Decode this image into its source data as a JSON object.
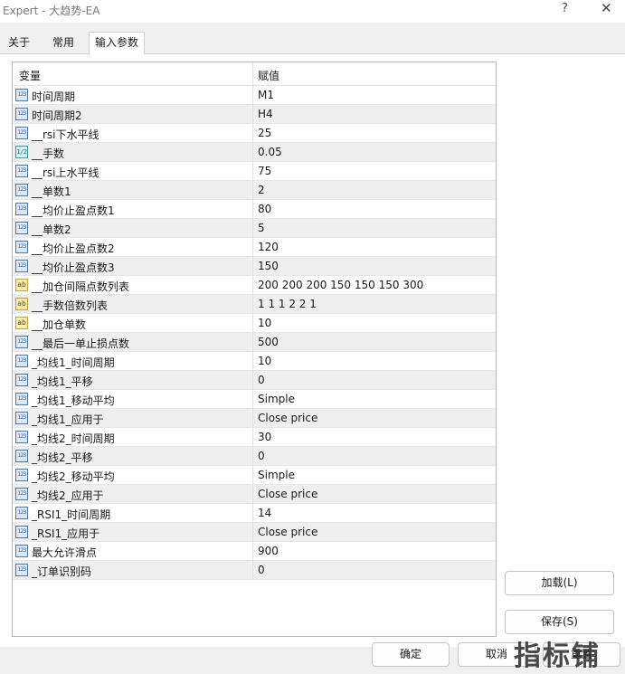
{
  "window": {
    "title": "Expert - 大趋势-EA",
    "help_label": "?",
    "close_label": "✕"
  },
  "tabs": [
    {
      "label": "关于"
    },
    {
      "label": "常用"
    },
    {
      "label": "输入参数"
    }
  ],
  "table": {
    "headers": {
      "name": "变量",
      "value": "赋值"
    },
    "rows": [
      {
        "icon": "123",
        "name": "时间周期",
        "value": "M1"
      },
      {
        "icon": "123",
        "name": "时间周期2",
        "value": "H4"
      },
      {
        "icon": "123",
        "name": "__rsi下水平线",
        "value": "25"
      },
      {
        "icon": "1/2",
        "name": "__手数",
        "value": "0.05"
      },
      {
        "icon": "123",
        "name": "__rsi上水平线",
        "value": "75"
      },
      {
        "icon": "123",
        "name": "__单数1",
        "value": "2"
      },
      {
        "icon": "123",
        "name": "__均价止盈点数1",
        "value": "80"
      },
      {
        "icon": "123",
        "name": "__单数2",
        "value": "5"
      },
      {
        "icon": "123",
        "name": "__均价止盈点数2",
        "value": "120"
      },
      {
        "icon": "123",
        "name": "__均价止盈点数3",
        "value": "150"
      },
      {
        "icon": "ab",
        "name": "__加仓间隔点数列表",
        "value": "200 200 200 150 150 150 300"
      },
      {
        "icon": "ab",
        "name": "__手数倍数列表",
        "value": "1 1 1 2 2 1"
      },
      {
        "icon": "ab",
        "name": "__加仓单数",
        "value": "10"
      },
      {
        "icon": "123",
        "name": "__最后一单止损点数",
        "value": "500"
      },
      {
        "icon": "123",
        "name": "_均线1_时间周期",
        "value": "10"
      },
      {
        "icon": "123",
        "name": "_均线1_平移",
        "value": "0"
      },
      {
        "icon": "123",
        "name": "_均线1_移动平均",
        "value": "Simple"
      },
      {
        "icon": "123",
        "name": "_均线1_应用于",
        "value": "Close price"
      },
      {
        "icon": "123",
        "name": "_均线2_时间周期",
        "value": "30"
      },
      {
        "icon": "123",
        "name": "_均线2_平移",
        "value": "0"
      },
      {
        "icon": "123",
        "name": "_均线2_移动平均",
        "value": "Simple"
      },
      {
        "icon": "123",
        "name": "_均线2_应用于",
        "value": "Close price"
      },
      {
        "icon": "123",
        "name": "_RSI1_时间周期",
        "value": "14"
      },
      {
        "icon": "123",
        "name": "_RSI1_应用于",
        "value": "Close price"
      },
      {
        "icon": "123",
        "name": "最大允许滑点",
        "value": "900"
      },
      {
        "icon": "123",
        "name": "_订单识别码",
        "value": "0"
      }
    ]
  },
  "buttons": {
    "load": "加载(L)",
    "save": "保存(S)",
    "ok": "确定",
    "cancel": "取消",
    "reset": "重置"
  },
  "watermark": "指标铺"
}
